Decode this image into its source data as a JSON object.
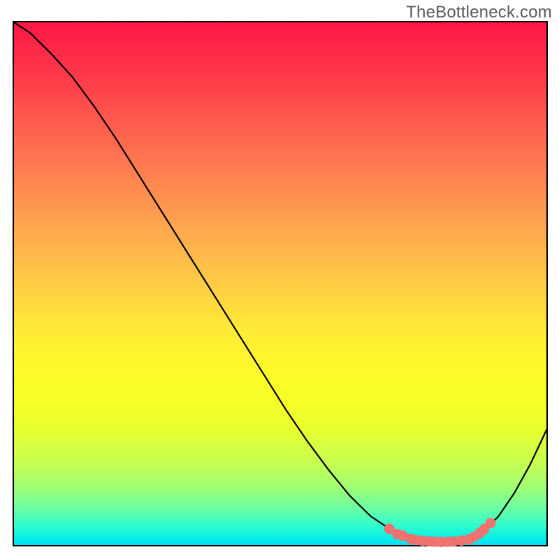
{
  "watermark": "TheBottleneck.com",
  "gradient": {
    "top": "#ff1744",
    "mid": "#ffee34",
    "bottom": "#00e0f6"
  },
  "chart_data": {
    "type": "line",
    "title": "",
    "xlabel": "",
    "ylabel": "",
    "xlim": [
      0,
      100
    ],
    "ylim": [
      0,
      100
    ],
    "grid": false,
    "series": [
      {
        "name": "bottleneck-curve",
        "x": [
          0,
          3,
          7,
          11,
          15,
          19,
          23,
          27,
          31,
          35,
          39,
          43,
          47,
          51,
          55,
          59,
          63,
          67,
          71,
          73,
          75,
          78,
          82,
          86,
          88,
          91,
          94,
          97,
          100
        ],
        "y": [
          100,
          98,
          94,
          89.5,
          84,
          78,
          71.5,
          65,
          58.5,
          52,
          45.5,
          39,
          32.5,
          26,
          20,
          14.5,
          9.5,
          5.5,
          2.8,
          1.8,
          1.1,
          0.7,
          0.6,
          1.0,
          2.4,
          5.5,
          10.0,
          15.5,
          22
        ]
      }
    ],
    "markers": {
      "name": "highlight-points",
      "x": [
        70.5,
        72.0,
        73.0,
        74.5,
        75.5,
        76.8,
        78.0,
        79.0,
        80.2,
        81.5,
        82.5,
        84.0,
        85.5,
        86.5,
        87.5,
        88.3,
        89.5
      ],
      "y": [
        3.1,
        2.1,
        1.8,
        1.2,
        0.95,
        0.8,
        0.7,
        0.65,
        0.6,
        0.62,
        0.68,
        0.85,
        1.1,
        1.6,
        2.3,
        3.0,
        4.2
      ]
    },
    "marker_radius_px": 7.5
  }
}
